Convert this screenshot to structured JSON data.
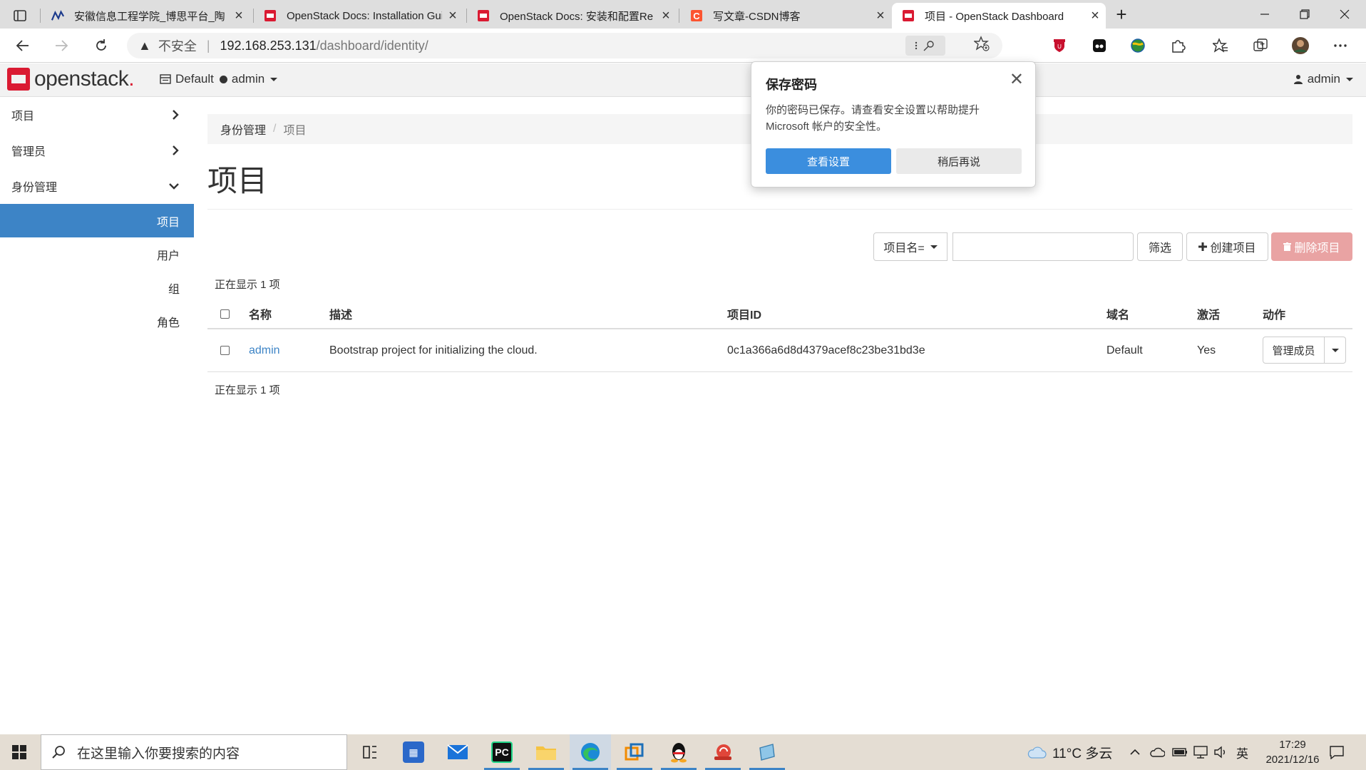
{
  "browser": {
    "tabs": [
      {
        "title": "安徽信息工程学院_博思平台_陶",
        "active": false
      },
      {
        "title": "OpenStack Docs: Installation Gui",
        "active": false
      },
      {
        "title": "OpenStack Docs: 安装和配置Re",
        "active": false
      },
      {
        "title": "写文章-CSDN博客",
        "active": false
      },
      {
        "title": "项目 - OpenStack Dashboard",
        "active": true
      }
    ],
    "new_tab_glyph": "+",
    "close_glyph": "×",
    "address": {
      "warning_glyph": "▲",
      "insecure_label": "不安全",
      "separator": "|",
      "host": "192.168.253.131",
      "path": "/dashboard/identity/"
    }
  },
  "openstack": {
    "logo_text_prefix": "open",
    "logo_text_suffix": "stack",
    "logo_dot": ".",
    "domain": "Default",
    "project": "admin",
    "user": "admin"
  },
  "sidebar": {
    "sections": [
      {
        "label": "项目",
        "icon": "chevron-right-icon"
      },
      {
        "label": "管理员",
        "icon": "chevron-right-icon"
      },
      {
        "label": "身份管理",
        "icon": "chevron-down-icon"
      }
    ],
    "items": [
      {
        "label": "项目",
        "active": true
      },
      {
        "label": "用户",
        "active": false
      },
      {
        "label": "组",
        "active": false
      },
      {
        "label": "角色",
        "active": false
      }
    ]
  },
  "breadcrumb": {
    "parent": "身份管理",
    "current": "项目",
    "separator": "/"
  },
  "page_title": "项目",
  "toolbar": {
    "filter_field": "项目名=",
    "filter_value": "",
    "filter_button": "筛选",
    "create_button": "创建项目",
    "delete_button": "删除项目"
  },
  "table": {
    "count_top": "正在显示 1 项",
    "count_bottom": "正在显示 1 项",
    "columns": [
      "名称",
      "描述",
      "项目ID",
      "域名",
      "激活",
      "动作"
    ],
    "rows": [
      {
        "name": "admin",
        "description": "Bootstrap project for initializing the cloud.",
        "project_id": "0c1a366a6d8d4379acef8c23be31bd3e",
        "domain": "Default",
        "enabled": "Yes",
        "action": "管理成员"
      }
    ]
  },
  "popup": {
    "title": "保存密码",
    "message": "你的密码已保存。请查看安全设置以帮助提升 Microsoft 帐户的安全性。",
    "primary_button": "查看设置",
    "secondary_button": "稍后再说",
    "close_glyph": "✕"
  },
  "taskbar": {
    "search_placeholder": "在这里输入你要搜索的内容",
    "weather": "11°C 多云",
    "ime": "英",
    "time": "17:29",
    "date": "2021/12/16"
  },
  "colors": {
    "accent_blue": "#3d84c6",
    "openstack_red": "#da1a32",
    "danger_disabled": "#e9a3a3",
    "popup_primary": "#3b8ede"
  }
}
